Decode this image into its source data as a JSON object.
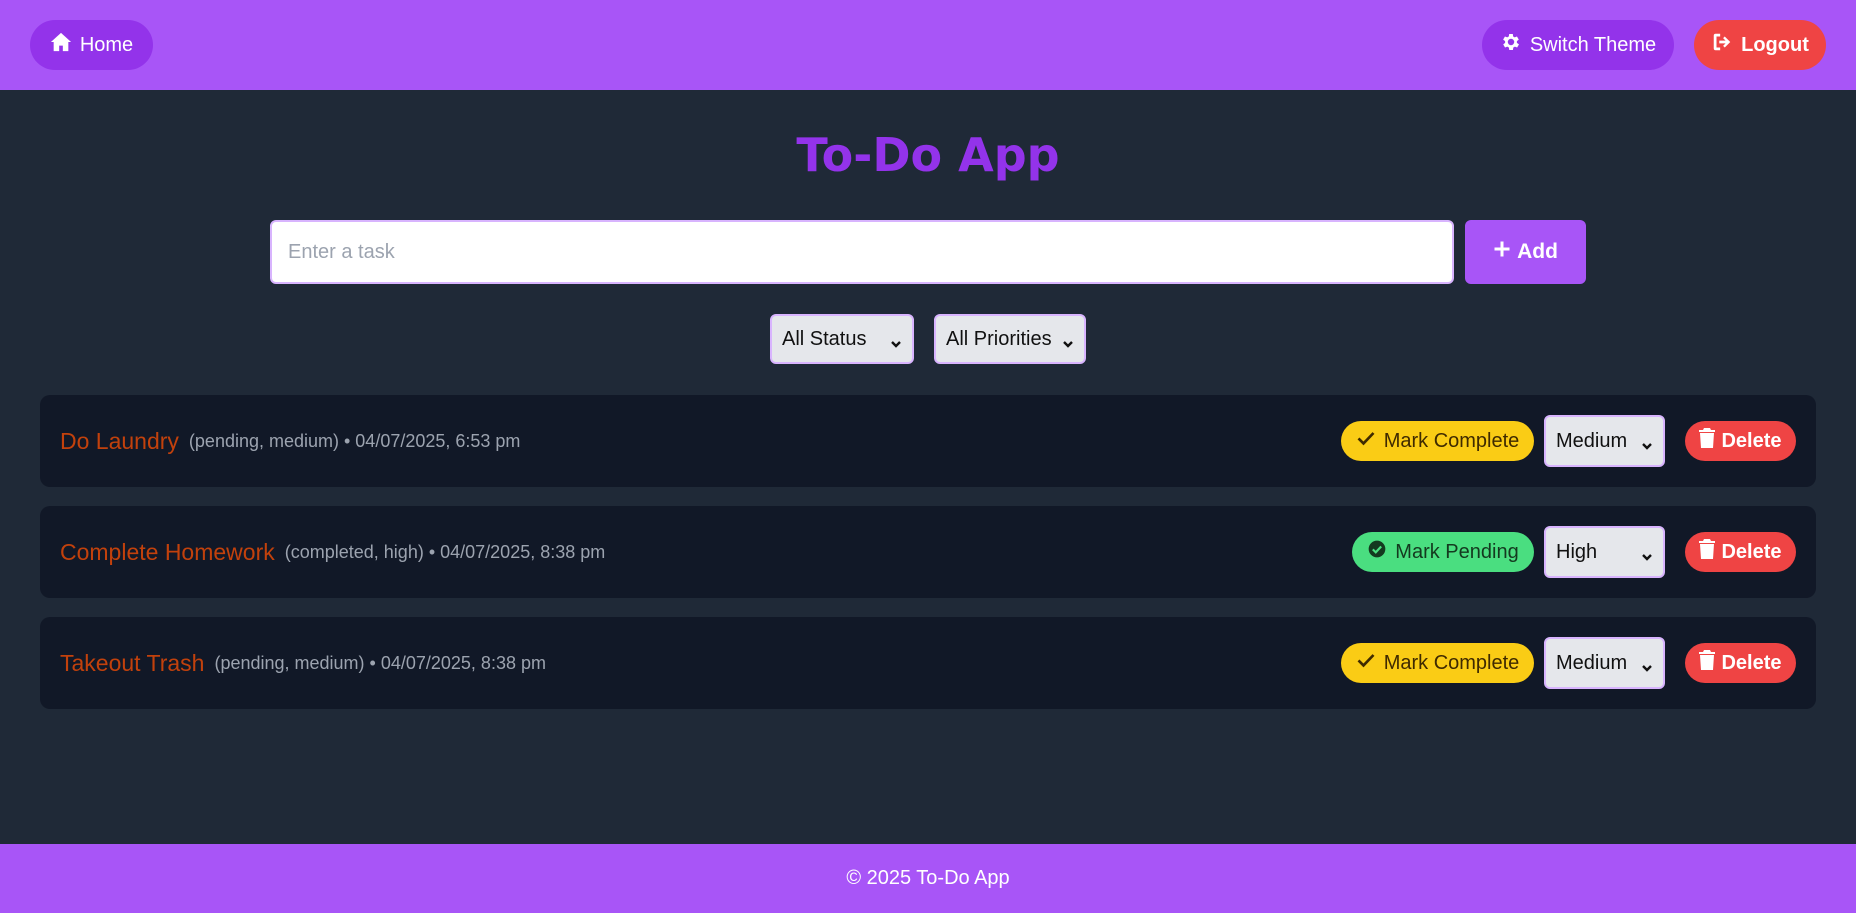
{
  "nav": {
    "home_label": "Home",
    "theme_label": "Switch Theme",
    "logout_label": "Logout"
  },
  "app_title": "To-Do App",
  "task_input": {
    "placeholder": "Enter a task",
    "value": ""
  },
  "add_label": "Add",
  "filters": {
    "status": "All Status",
    "priority": "All Priorities"
  },
  "tasks": [
    {
      "name": "Do Laundry",
      "meta": "(pending, medium) • 04/07/2025, 6:53 pm",
      "action": "Mark Complete",
      "priority": "Medium",
      "delete": "Delete"
    },
    {
      "name": "Complete Homework",
      "meta": "(completed, high) • 04/07/2025, 8:38 pm",
      "action": "Mark Pending",
      "priority": "High",
      "delete": "Delete"
    },
    {
      "name": "Takeout Trash",
      "meta": "(pending, medium) • 04/07/2025, 8:38 pm",
      "action": "Mark Complete",
      "priority": "Medium",
      "delete": "Delete"
    }
  ],
  "footer_text": "© 2025 To-Do App",
  "colors": {
    "header": "#a855f7",
    "background": "#1f2937",
    "card": "#111827",
    "accent": "#9333ea",
    "danger": "#ef4444",
    "complete": "#facc15",
    "pending": "#4ade80",
    "task_name": "#c2410c"
  }
}
